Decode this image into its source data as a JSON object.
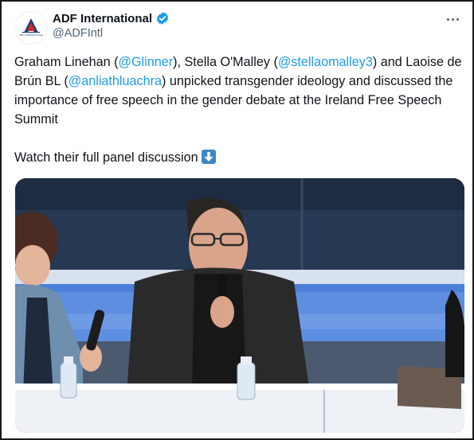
{
  "tweet": {
    "author": {
      "display_name": "ADF International",
      "handle": "@ADFIntl",
      "verified": true,
      "avatar_logo_text": "ADF INTERNATIONAL"
    },
    "text_parts": {
      "p1": "Graham Linehan (",
      "m1": "@Glinner",
      "p2": "), Stella O'Malley (",
      "m2": "@stellaomalley3",
      "p3": ") and Laoise de Brún BL (",
      "m3": "@anliathluachra",
      "p4": ") unpicked transgender ideology and discussed the importance of free speech in the gender debate at the Ireland Free Speech Summit",
      "p5": "Watch their full panel discussion"
    },
    "emoji": "down-arrow-emoji",
    "media": {
      "type": "video-thumbnail"
    }
  },
  "colors": {
    "link": "#1d9bf0",
    "verified": "#1d9bf0",
    "text": "#0f1419",
    "secondary": "#536471",
    "brand_red": "#d62a2a",
    "brand_blue": "#1d3f78"
  },
  "icons": [
    "adf-logo-icon",
    "verified-badge-icon",
    "more-options-icon",
    "down-arrow-emoji-icon"
  ]
}
